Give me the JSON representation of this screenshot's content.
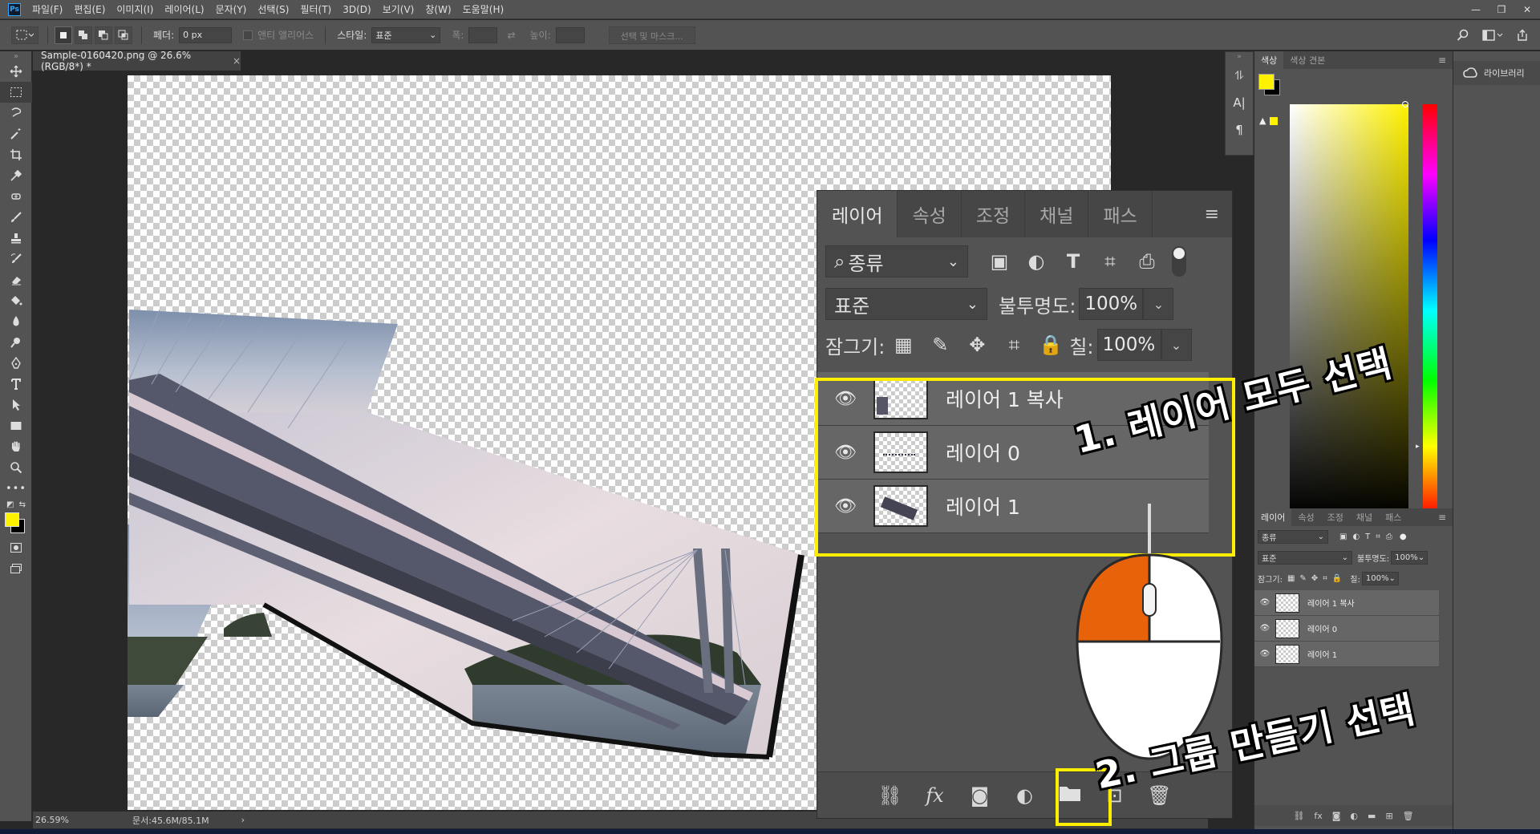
{
  "app": {
    "logo": "Ps",
    "menu": [
      "파일(F)",
      "편집(E)",
      "이미지(I)",
      "레이어(L)",
      "문자(Y)",
      "선택(S)",
      "필터(T)",
      "3D(D)",
      "보기(V)",
      "창(W)",
      "도움말(H)"
    ],
    "window_controls": {
      "minimize": "—",
      "restore": "❐",
      "close": "✕"
    }
  },
  "options": {
    "feather_label": "페더:",
    "feather_value": "0 px",
    "antialias_label": "앤티 앨리어스",
    "style_label": "스타일:",
    "style_value": "표준",
    "width_label": "폭:",
    "height_label": "높이:",
    "select_mask_label": "선택 및 마스크..."
  },
  "document": {
    "tab_title": "Sample-0160420.png @ 26.6% (RGB/8*) *",
    "close_glyph": "×",
    "zoom": "26.59%",
    "doc_size": "문서:45.6M/85.1M",
    "status_arrow": "›"
  },
  "color_panel": {
    "tabs": [
      "색상",
      "색상 견본"
    ],
    "foreground": "#fff200",
    "background": "#000000",
    "warning": "▲"
  },
  "library": {
    "label": "라이브러리"
  },
  "layers_panel": {
    "tabs": [
      "레이어",
      "속성",
      "조정",
      "채널",
      "패스"
    ],
    "filter_kind": "종류",
    "blend_mode": "표준",
    "opacity_label": "불투명도:",
    "opacity_value": "100%",
    "lock_label": "잠그기:",
    "fill_label": "칠:",
    "fill_value": "100%",
    "layers": [
      {
        "name": "레이어 1 복사"
      },
      {
        "name": "레이어 0"
      },
      {
        "name": "레이어 1"
      }
    ]
  },
  "small_layers_panel": {
    "tabs": [
      "레이어",
      "속성",
      "조정",
      "채널",
      "패스"
    ],
    "filter_kind": "종류",
    "blend_mode": "표준",
    "opacity_label": "불투명도:",
    "opacity_value": "100%",
    "lock_label": "잠그기:",
    "fill_label": "칠:",
    "fill_value": "100%",
    "layers": [
      {
        "name": "레이어 1 복사"
      },
      {
        "name": "레이어 0"
      },
      {
        "name": "레이어 1"
      }
    ]
  },
  "annotations": {
    "step1": "1. 레이어 모두 선택",
    "step2": "2. 그룹 만들기 선택",
    "highlight_color": "#ffee00",
    "mouse_button_color": "#e8620a"
  }
}
